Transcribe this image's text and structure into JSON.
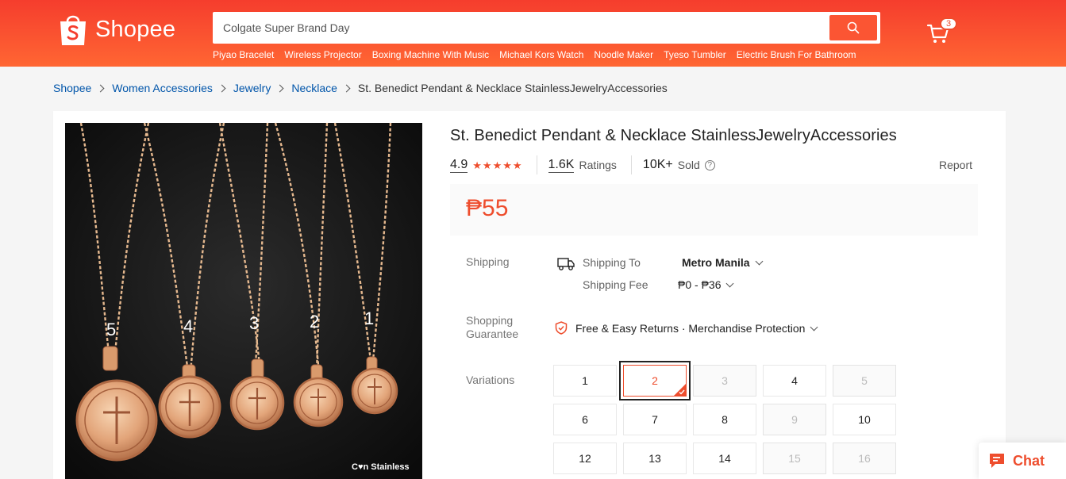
{
  "header": {
    "logo_text": "Shopee",
    "search_placeholder": "Colgate Super Brand Day",
    "hot_keywords": [
      "Piyao Bracelet",
      "Wireless Projector",
      "Boxing Machine With Music",
      "Michael Kors Watch",
      "Noodle Maker",
      "Tyeso Tumbler",
      "Electric Brush For Bathroom"
    ],
    "cart_count": "3"
  },
  "breadcrumb": {
    "items": [
      "Shopee",
      "Women Accessories",
      "Jewelry",
      "Necklace"
    ],
    "current": "St. Benedict Pendant & Necklace StainlessJewelryAccessories"
  },
  "product": {
    "image": {
      "pendant_numbers": [
        "5",
        "4",
        "3",
        "2",
        "1"
      ],
      "watermark": "C♥n Stainless"
    },
    "title": "St. Benedict Pendant & Necklace StainlessJewelryAccessories",
    "rating": "4.9",
    "ratings_count": "1.6K",
    "ratings_label": "Ratings",
    "sold_count": "10K+",
    "sold_label": "Sold",
    "report_label": "Report",
    "price": "₱55",
    "shipping": {
      "label": "Shipping",
      "to_label": "Shipping To",
      "to_value": "Metro Manila",
      "fee_label": "Shipping Fee",
      "fee_value": "₱0 - ₱36"
    },
    "guarantee": {
      "label_line1": "Shopping",
      "label_line2": "Guarantee",
      "value": "Free & Easy Returns · Merchandise Protection"
    },
    "variations": {
      "label": "Variations",
      "options": [
        {
          "label": "1",
          "state": "available"
        },
        {
          "label": "2",
          "state": "selected"
        },
        {
          "label": "3",
          "state": "disabled"
        },
        {
          "label": "4",
          "state": "available"
        },
        {
          "label": "5",
          "state": "disabled"
        },
        {
          "label": "6",
          "state": "available"
        },
        {
          "label": "7",
          "state": "available"
        },
        {
          "label": "8",
          "state": "available"
        },
        {
          "label": "9",
          "state": "disabled"
        },
        {
          "label": "10",
          "state": "available"
        },
        {
          "label": "12",
          "state": "available"
        },
        {
          "label": "13",
          "state": "available"
        },
        {
          "label": "14",
          "state": "available"
        },
        {
          "label": "15",
          "state": "disabled"
        },
        {
          "label": "16",
          "state": "disabled"
        }
      ]
    }
  },
  "chat": {
    "label": "Chat"
  },
  "colors": {
    "brand": "#ee4d2d",
    "link": "#0055aa"
  }
}
